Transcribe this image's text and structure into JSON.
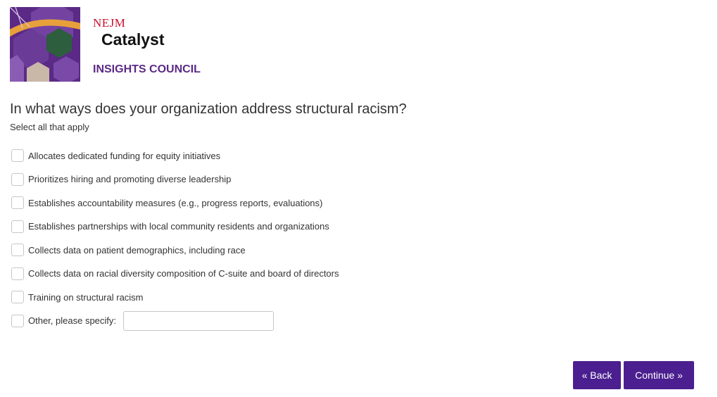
{
  "brand": {
    "nejm": "NEJM",
    "catalyst": "Catalyst",
    "council": "INSIGHTS COUNCIL",
    "colors": {
      "purple": "#5b2a86",
      "red": "#c8102e",
      "orange": "#e8a13a",
      "green": "#2d5e3e"
    }
  },
  "question": {
    "title": "In what ways does your organization address structural racism?",
    "hint": "Select all that apply"
  },
  "options": [
    {
      "label": "Allocates dedicated funding for equity initiatives",
      "checked": false
    },
    {
      "label": "Prioritizes hiring and promoting diverse leadership",
      "checked": false
    },
    {
      "label": "Establishes accountability measures (e.g., progress reports, evaluations)",
      "checked": false
    },
    {
      "label": "Establishes partnerships with local community residents and organizations",
      "checked": false
    },
    {
      "label": "Collects data on patient demographics, including race",
      "checked": false
    },
    {
      "label": "Collects data on racial diversity composition of C-suite and board of directors",
      "checked": false
    },
    {
      "label": "Training on structural racism",
      "checked": false
    },
    {
      "label": "Other, please specify:",
      "checked": false
    }
  ],
  "other_input": {
    "value": "",
    "placeholder": ""
  },
  "nav": {
    "back_label": "« Back",
    "continue_label": "Continue »",
    "button_color": "#4b1f8f"
  }
}
